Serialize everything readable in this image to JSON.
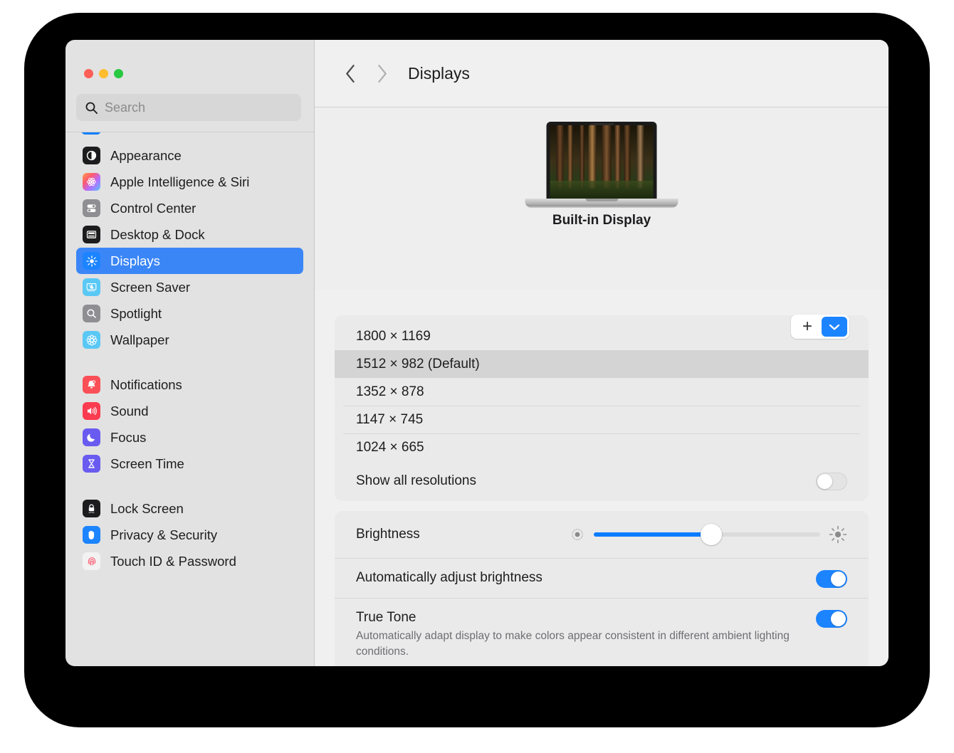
{
  "window": {
    "traffic_lights": [
      "close",
      "minimize",
      "zoom"
    ]
  },
  "search": {
    "placeholder": "Search",
    "value": "",
    "icon": "search-icon"
  },
  "sidebar": {
    "groups": [
      {
        "items": [
          {
            "label": "Appearance",
            "icon": "appearance-icon",
            "selected": false
          },
          {
            "label": "Apple Intelligence & Siri",
            "icon": "apple-intelligence-icon",
            "selected": false
          },
          {
            "label": "Control Center",
            "icon": "control-center-icon",
            "selected": false
          },
          {
            "label": "Desktop & Dock",
            "icon": "desktop-dock-icon",
            "selected": false
          },
          {
            "label": "Displays",
            "icon": "displays-icon",
            "selected": true
          },
          {
            "label": "Screen Saver",
            "icon": "screen-saver-icon",
            "selected": false
          },
          {
            "label": "Spotlight",
            "icon": "spotlight-icon",
            "selected": false
          },
          {
            "label": "Wallpaper",
            "icon": "wallpaper-icon",
            "selected": false
          }
        ]
      },
      {
        "items": [
          {
            "label": "Notifications",
            "icon": "notifications-icon",
            "selected": false
          },
          {
            "label": "Sound",
            "icon": "sound-icon",
            "selected": false
          },
          {
            "label": "Focus",
            "icon": "focus-icon",
            "selected": false
          },
          {
            "label": "Screen Time",
            "icon": "screen-time-icon",
            "selected": false
          }
        ]
      },
      {
        "items": [
          {
            "label": "Lock Screen",
            "icon": "lock-screen-icon",
            "selected": false
          },
          {
            "label": "Privacy & Security",
            "icon": "privacy-security-icon",
            "selected": false
          },
          {
            "label": "Touch ID & Password",
            "icon": "touch-id-icon",
            "selected": false
          }
        ]
      }
    ]
  },
  "header": {
    "title": "Displays",
    "back_icon": "chevron-left-icon",
    "forward_icon": "chevron-right-icon",
    "back_enabled": true,
    "forward_enabled": false
  },
  "display": {
    "name": "Built-in Display",
    "add_label": "+",
    "add_menu_icon": "chevron-down-icon"
  },
  "resolutions": {
    "options": [
      {
        "label": "1800 × 1169",
        "selected": false,
        "separator": false
      },
      {
        "label": "1512 × 982 (Default)",
        "selected": true,
        "separator": false
      },
      {
        "label": "1352 × 878",
        "selected": false,
        "separator": false
      },
      {
        "label": "1147 × 745",
        "selected": false,
        "separator": true
      },
      {
        "label": "1024 × 665",
        "selected": false,
        "separator": true
      }
    ],
    "show_all": {
      "label": "Show all resolutions",
      "enabled": false
    }
  },
  "brightness": {
    "label": "Brightness",
    "value_percent": 52,
    "low_icon": "brightness-low-icon",
    "high_icon": "brightness-high-icon"
  },
  "options": [
    {
      "label": "Automatically adjust brightness",
      "description": "",
      "enabled": true
    },
    {
      "label": "True Tone",
      "description": "Automatically adapt display to make colors appear consistent in different ambient lighting conditions.",
      "enabled": true
    }
  ],
  "colors": {
    "accent": "#1c84ff",
    "selection": "#3b86f7",
    "sidebar_bg": "#e2e2e2",
    "content_bg": "#f0f0f0"
  }
}
